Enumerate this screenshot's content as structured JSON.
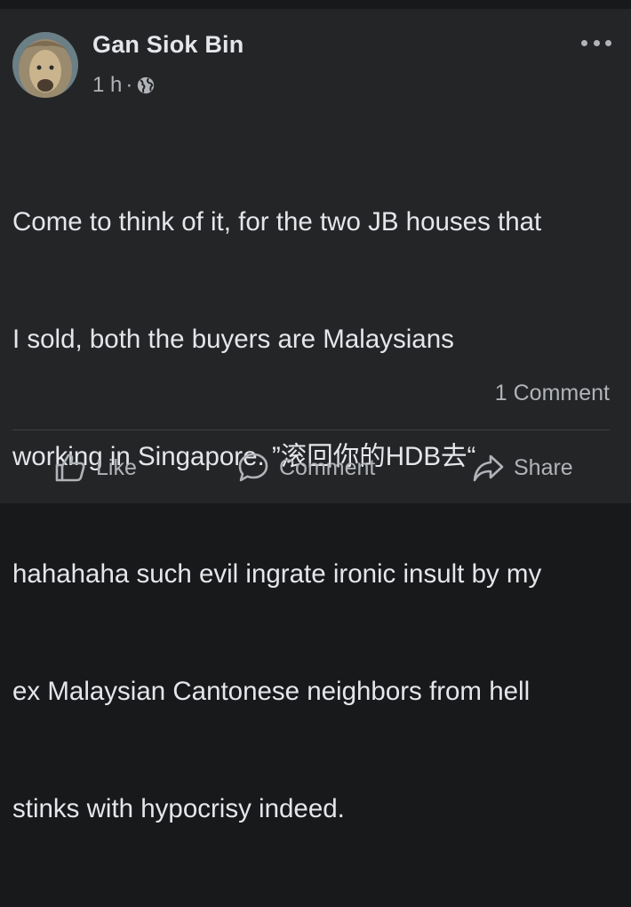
{
  "post": {
    "author": "Gan Siok Bin",
    "time": "1 h",
    "separator": "·",
    "privacy_icon": "globe-icon",
    "more_icon": "more-options-icon",
    "text_lines": [
      "Come to think of it, for the two JB houses that",
      "I sold, both the buyers are Malaysians",
      "working in Singapore. ”滚回你的HDB去“",
      "hahahaha such evil ingrate ironic insult by my",
      "ex Malaysian Cantonese neighbors from hell",
      "stinks with hypocrisy indeed."
    ],
    "comment_count": "1 Comment"
  },
  "actions": {
    "like": {
      "label": "Like",
      "icon": "thumbs-up-icon"
    },
    "comment": {
      "label": "Comment",
      "icon": "speech-bubble-icon"
    },
    "share": {
      "label": "Share",
      "icon": "share-arrow-icon"
    }
  },
  "colors": {
    "page_bg": "#18191a",
    "card_bg": "#242526",
    "primary_text": "#e4e6eb",
    "secondary_text": "#b0b3b8",
    "divider": "#3e4042"
  }
}
